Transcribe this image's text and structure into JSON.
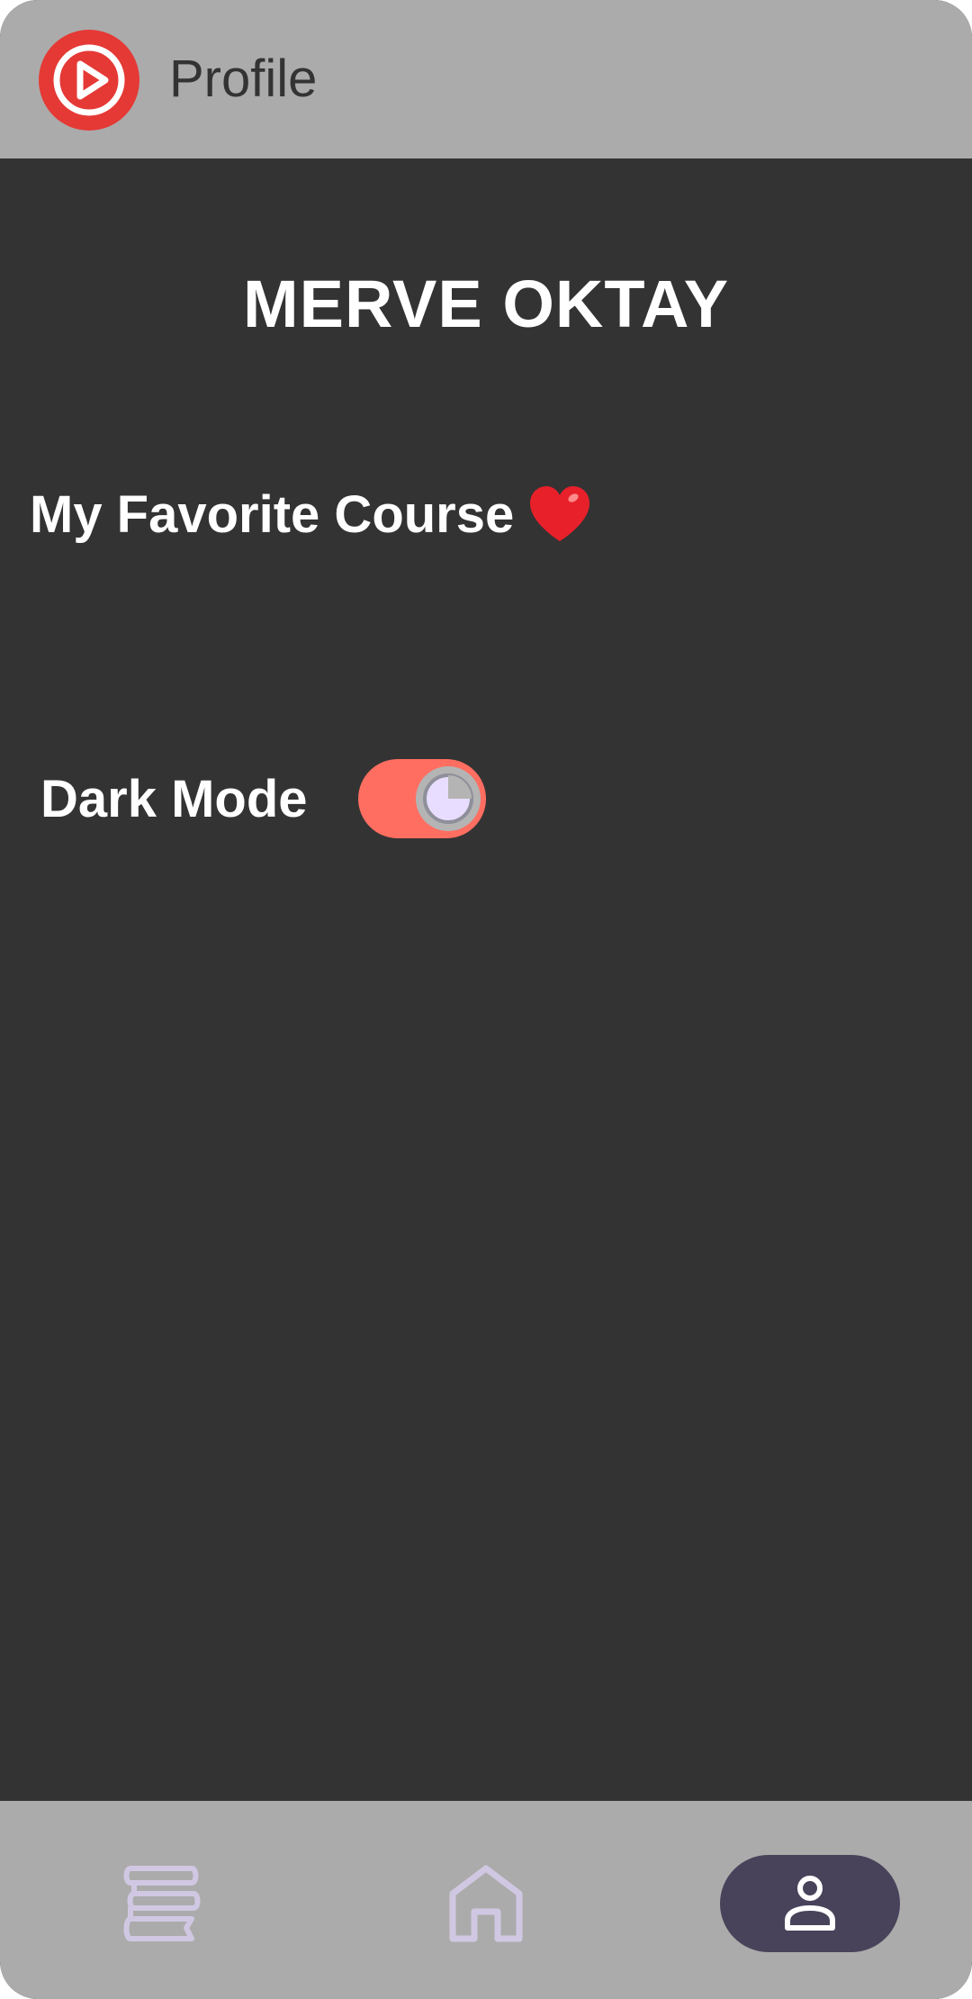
{
  "app_bar": {
    "title": "Profile",
    "logo_icon": "play-circle-logo",
    "background": "#ababab"
  },
  "profile": {
    "name": "MERVE OKTAY",
    "favorite_label": "My Favorite Course",
    "favorite_icon": "heart-icon",
    "dark_mode_label": "Dark Mode",
    "dark_mode_enabled": true
  },
  "colors": {
    "background": "#333333",
    "accent": "#ff6e61",
    "logo_red": "#e53935",
    "nav_selected": "#48435a"
  },
  "bottom_nav": {
    "items": [
      {
        "id": "courses",
        "icon": "stacked-books-icon",
        "selected": false
      },
      {
        "id": "home",
        "icon": "home-icon",
        "selected": false
      },
      {
        "id": "profile",
        "icon": "person-icon",
        "selected": true
      }
    ]
  }
}
